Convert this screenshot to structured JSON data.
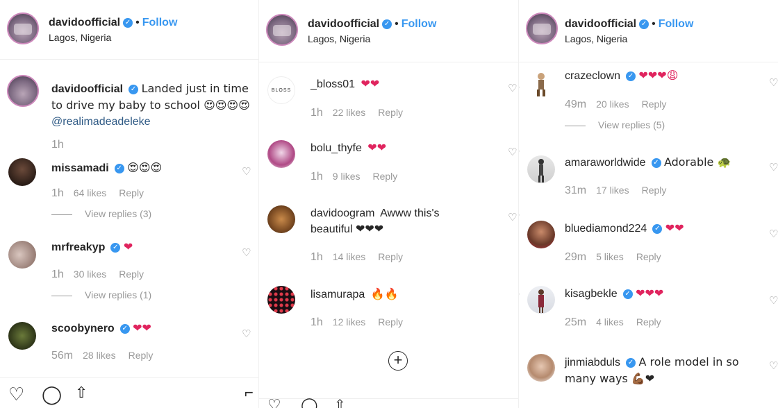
{
  "posts": [
    {
      "username": "davidoofficial",
      "follow": "Follow",
      "location": "Lagos, Nigeria"
    },
    {
      "username": "davidoofficial",
      "follow": "Follow",
      "location": "Lagos, Nigeria"
    },
    {
      "username": "davidoofficial",
      "follow": "Follow",
      "location": "Lagos, Nigeria"
    }
  ],
  "caption": {
    "username": "davidoofficial",
    "text": "Landed just in time to drive my baby to school 😍😍😍😍",
    "mention": "@realimadeadeleke",
    "time": "1h"
  },
  "panel1": [
    {
      "user": "missamadi",
      "text": "😍😍😍",
      "time": "1h",
      "likes": "64 likes",
      "reply": "Reply",
      "view": "View replies (3)"
    },
    {
      "user": "mrfreakyp",
      "text": "❤",
      "time": "1h",
      "likes": "30 likes",
      "reply": "Reply",
      "view": "View replies (1)"
    },
    {
      "user": "scoobynero",
      "text": "❤❤",
      "time": "56m",
      "likes": "28 likes",
      "reply": "Reply"
    }
  ],
  "panel2": [
    {
      "user": "_bloss01",
      "text": "❤❤",
      "time": "1h",
      "likes": "22 likes",
      "reply": "Reply"
    },
    {
      "user": "bolu_thyfe",
      "text": "❤❤",
      "time": "1h",
      "likes": "9 likes",
      "reply": "Reply"
    },
    {
      "user": "davidoogram",
      "text": "Awww this's beautiful ❤❤❤",
      "time": "1h",
      "likes": "14 likes",
      "reply": "Reply"
    },
    {
      "user": "lisamurapa",
      "text": "🔥🔥",
      "time": "1h",
      "likes": "12 likes",
      "reply": "Reply"
    }
  ],
  "panel3": [
    {
      "user": "crazeclown",
      "text": "❤❤❤😩",
      "time": "49m",
      "likes": "20 likes",
      "reply": "Reply",
      "view": "View replies (5)"
    },
    {
      "user": "amaraworldwide",
      "text": "Adorable 🐢",
      "time": "31m",
      "likes": "17 likes",
      "reply": "Reply"
    },
    {
      "user": "bluediamond224",
      "text": "❤❤",
      "time": "29m",
      "likes": "5 likes",
      "reply": "Reply"
    },
    {
      "user": "kisagbekle",
      "text": "❤❤❤",
      "time": "25m",
      "likes": "4 likes",
      "reply": "Reply"
    },
    {
      "user": "jinmiabduls",
      "text": "A role model in so many ways 💪🏾❤",
      "time": "",
      "likes": "",
      "reply": ""
    }
  ],
  "bloss_label": "BLOSS",
  "icons": {
    "heart": "heart-outline-icon",
    "comment": "comment-icon",
    "share": "share-icon",
    "bookmark": "bookmark-icon",
    "plus": "load-more-icon",
    "verified": "verified-badge-icon",
    "more": "more-options-icon"
  },
  "colors": {
    "link": "#3897f0",
    "heart": "#e0245e",
    "muted": "#999999"
  }
}
